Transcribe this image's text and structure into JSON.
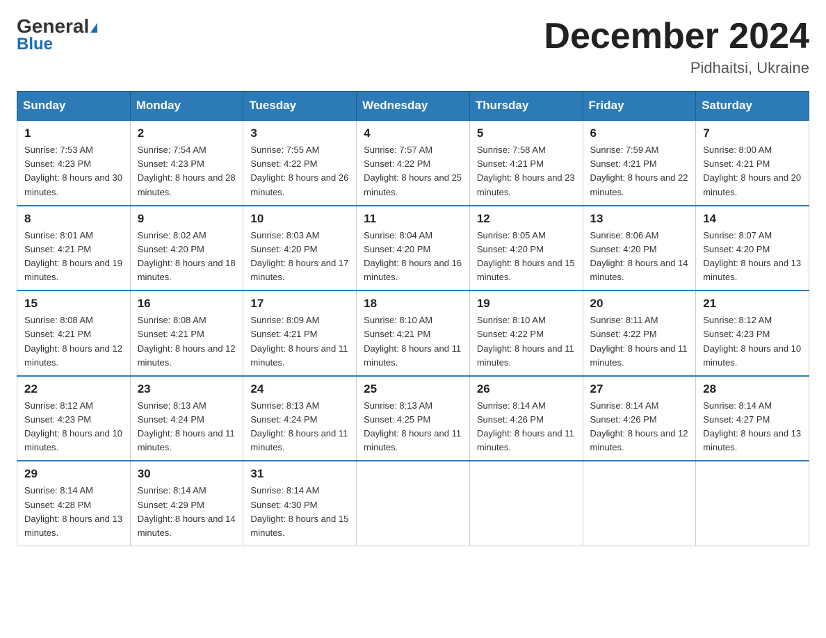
{
  "header": {
    "logo_general": "General",
    "logo_blue": "Blue",
    "month_title": "December 2024",
    "subtitle": "Pidhaitsi, Ukraine"
  },
  "weekdays": [
    "Sunday",
    "Monday",
    "Tuesday",
    "Wednesday",
    "Thursday",
    "Friday",
    "Saturday"
  ],
  "weeks": [
    [
      {
        "day": "1",
        "sunrise": "7:53 AM",
        "sunset": "4:23 PM",
        "daylight": "8 hours and 30 minutes."
      },
      {
        "day": "2",
        "sunrise": "7:54 AM",
        "sunset": "4:23 PM",
        "daylight": "8 hours and 28 minutes."
      },
      {
        "day": "3",
        "sunrise": "7:55 AM",
        "sunset": "4:22 PM",
        "daylight": "8 hours and 26 minutes."
      },
      {
        "day": "4",
        "sunrise": "7:57 AM",
        "sunset": "4:22 PM",
        "daylight": "8 hours and 25 minutes."
      },
      {
        "day": "5",
        "sunrise": "7:58 AM",
        "sunset": "4:21 PM",
        "daylight": "8 hours and 23 minutes."
      },
      {
        "day": "6",
        "sunrise": "7:59 AM",
        "sunset": "4:21 PM",
        "daylight": "8 hours and 22 minutes."
      },
      {
        "day": "7",
        "sunrise": "8:00 AM",
        "sunset": "4:21 PM",
        "daylight": "8 hours and 20 minutes."
      }
    ],
    [
      {
        "day": "8",
        "sunrise": "8:01 AM",
        "sunset": "4:21 PM",
        "daylight": "8 hours and 19 minutes."
      },
      {
        "day": "9",
        "sunrise": "8:02 AM",
        "sunset": "4:20 PM",
        "daylight": "8 hours and 18 minutes."
      },
      {
        "day": "10",
        "sunrise": "8:03 AM",
        "sunset": "4:20 PM",
        "daylight": "8 hours and 17 minutes."
      },
      {
        "day": "11",
        "sunrise": "8:04 AM",
        "sunset": "4:20 PM",
        "daylight": "8 hours and 16 minutes."
      },
      {
        "day": "12",
        "sunrise": "8:05 AM",
        "sunset": "4:20 PM",
        "daylight": "8 hours and 15 minutes."
      },
      {
        "day": "13",
        "sunrise": "8:06 AM",
        "sunset": "4:20 PM",
        "daylight": "8 hours and 14 minutes."
      },
      {
        "day": "14",
        "sunrise": "8:07 AM",
        "sunset": "4:20 PM",
        "daylight": "8 hours and 13 minutes."
      }
    ],
    [
      {
        "day": "15",
        "sunrise": "8:08 AM",
        "sunset": "4:21 PM",
        "daylight": "8 hours and 12 minutes."
      },
      {
        "day": "16",
        "sunrise": "8:08 AM",
        "sunset": "4:21 PM",
        "daylight": "8 hours and 12 minutes."
      },
      {
        "day": "17",
        "sunrise": "8:09 AM",
        "sunset": "4:21 PM",
        "daylight": "8 hours and 11 minutes."
      },
      {
        "day": "18",
        "sunrise": "8:10 AM",
        "sunset": "4:21 PM",
        "daylight": "8 hours and 11 minutes."
      },
      {
        "day": "19",
        "sunrise": "8:10 AM",
        "sunset": "4:22 PM",
        "daylight": "8 hours and 11 minutes."
      },
      {
        "day": "20",
        "sunrise": "8:11 AM",
        "sunset": "4:22 PM",
        "daylight": "8 hours and 11 minutes."
      },
      {
        "day": "21",
        "sunrise": "8:12 AM",
        "sunset": "4:23 PM",
        "daylight": "8 hours and 10 minutes."
      }
    ],
    [
      {
        "day": "22",
        "sunrise": "8:12 AM",
        "sunset": "4:23 PM",
        "daylight": "8 hours and 10 minutes."
      },
      {
        "day": "23",
        "sunrise": "8:13 AM",
        "sunset": "4:24 PM",
        "daylight": "8 hours and 11 minutes."
      },
      {
        "day": "24",
        "sunrise": "8:13 AM",
        "sunset": "4:24 PM",
        "daylight": "8 hours and 11 minutes."
      },
      {
        "day": "25",
        "sunrise": "8:13 AM",
        "sunset": "4:25 PM",
        "daylight": "8 hours and 11 minutes."
      },
      {
        "day": "26",
        "sunrise": "8:14 AM",
        "sunset": "4:26 PM",
        "daylight": "8 hours and 11 minutes."
      },
      {
        "day": "27",
        "sunrise": "8:14 AM",
        "sunset": "4:26 PM",
        "daylight": "8 hours and 12 minutes."
      },
      {
        "day": "28",
        "sunrise": "8:14 AM",
        "sunset": "4:27 PM",
        "daylight": "8 hours and 13 minutes."
      }
    ],
    [
      {
        "day": "29",
        "sunrise": "8:14 AM",
        "sunset": "4:28 PM",
        "daylight": "8 hours and 13 minutes."
      },
      {
        "day": "30",
        "sunrise": "8:14 AM",
        "sunset": "4:29 PM",
        "daylight": "8 hours and 14 minutes."
      },
      {
        "day": "31",
        "sunrise": "8:14 AM",
        "sunset": "4:30 PM",
        "daylight": "8 hours and 15 minutes."
      },
      null,
      null,
      null,
      null
    ]
  ]
}
